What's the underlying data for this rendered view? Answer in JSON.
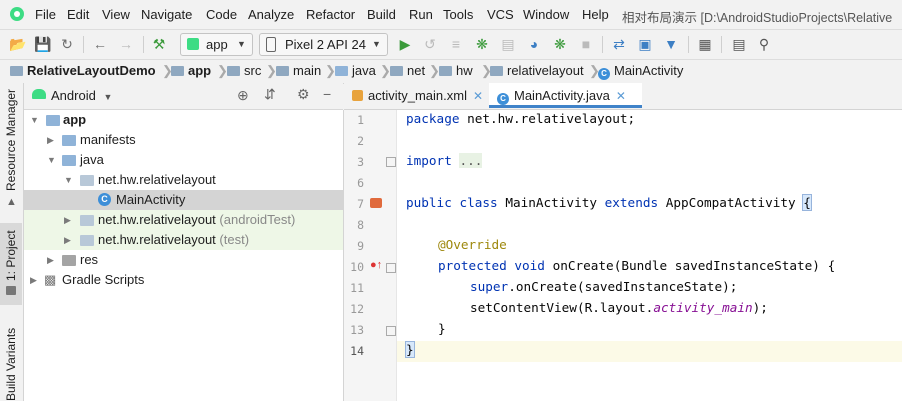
{
  "menu": {
    "items": [
      "File",
      "Edit",
      "View",
      "Navigate",
      "Code",
      "Analyze",
      "Refactor",
      "Build",
      "Run",
      "Tools",
      "VCS",
      "Window",
      "Help"
    ],
    "window_title": "相对布局演示 [D:\\AndroidStudioProjects\\Relative"
  },
  "toolbar": {
    "run_config": "app",
    "device": "Pixel 2 API 24"
  },
  "breadcrumb": [
    "RelativeLayoutDemo",
    "app",
    "src",
    "main",
    "java",
    "net",
    "hw",
    "relativelayout",
    "MainActivity"
  ],
  "stripe": {
    "resource_manager": "Resource Manager",
    "project": "1: Project",
    "build_variants": "Build Variants"
  },
  "project_panel": {
    "view_mode": "Android",
    "tree": [
      {
        "label": "app",
        "suffix": ""
      },
      {
        "label": "manifests",
        "suffix": ""
      },
      {
        "label": "java",
        "suffix": ""
      },
      {
        "label": "net.hw.relativelayout",
        "suffix": ""
      },
      {
        "label": "MainActivity",
        "suffix": ""
      },
      {
        "label": "net.hw.relativelayout",
        "suffix": "(androidTest)"
      },
      {
        "label": "net.hw.relativelayout",
        "suffix": "(test)"
      },
      {
        "label": "res",
        "suffix": ""
      },
      {
        "label": "Gradle Scripts",
        "suffix": ""
      }
    ]
  },
  "editor": {
    "tabs": [
      "activity_main.xml",
      "MainActivity.java"
    ],
    "active_tab": "MainActivity.java",
    "line_numbers": [
      "1",
      "2",
      "3",
      "6",
      "7",
      "8",
      "9",
      "10",
      "11",
      "12",
      "13",
      "14"
    ],
    "code": {
      "l1_kw": "package",
      "l1_rest": " net.hw.relativelayout;",
      "l3_kw": "import",
      "l3_fold": "...",
      "l7_kw1": "public",
      "l7_kw2": "class",
      "l7_name": " MainActivity ",
      "l7_kw3": "extends",
      "l7_rest": " AppCompatActivity ",
      "l7_brace": "{",
      "l9_ann": "@Override",
      "l10_kw1": "protected",
      "l10_kw2": "void",
      "l10_rest": " onCreate(Bundle savedInstanceState) {",
      "l11_kw": "super",
      "l11_rest": ".onCreate(savedInstanceState);",
      "l12_a": "setContentView(R.layout.",
      "l12_fld": "activity_main",
      "l12_b": ");",
      "l13": "}",
      "l14": "}"
    }
  }
}
